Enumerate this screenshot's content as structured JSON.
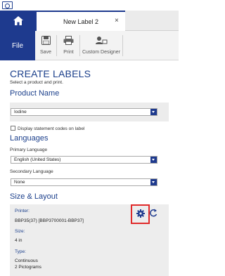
{
  "tabs": {
    "document_tab": "New Label 2"
  },
  "toolbar": {
    "file_label": "File",
    "save_label": "Save",
    "print_label": "Print",
    "custom_designer_label": "Custom Designer"
  },
  "page": {
    "title": "CREATE LABELS",
    "subtitle": "Select a product and print."
  },
  "product": {
    "heading": "Product Name",
    "selected": "Iodine",
    "display_codes_checkbox_label": "Display statement codes on label",
    "display_codes_checked": false
  },
  "languages": {
    "heading": "Languages",
    "primary_label": "Primary Language",
    "primary_selected": "English (United States)",
    "secondary_label": "Secondary Language",
    "secondary_selected": "None"
  },
  "size_layout": {
    "heading": "Size & Layout",
    "printer_label": "Printer:",
    "printer_value": "BBP35(37) [BBP3700001-BBP37]",
    "size_label": "Size:",
    "size_value": "4 in",
    "type_label": "Type:",
    "type_value_1": "Continuous",
    "type_value_2": "2 Pictograms"
  },
  "colors": {
    "brand_blue": "#1e3a8e",
    "heading_blue": "#1b3f8b",
    "highlight_red": "#e02a2a"
  },
  "icons": [
    "app-icon",
    "home-icon",
    "close-icon",
    "save-icon",
    "print-icon",
    "custom-designer-icon",
    "chevron-down-icon",
    "gear-icon",
    "refresh-icon"
  ]
}
